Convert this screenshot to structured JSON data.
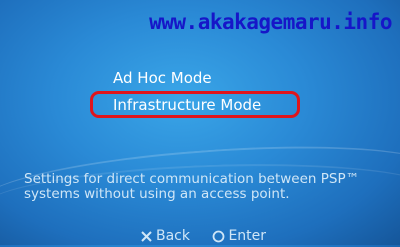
{
  "watermark": "www.akakagemaru.info",
  "menu": {
    "items": [
      {
        "label": "Ad Hoc Mode"
      },
      {
        "label": "Infrastructure Mode"
      }
    ]
  },
  "description": "Settings for direct communication between PSP™ systems without using an access point.",
  "footer": {
    "back_label": "Back",
    "enter_label": "Enter",
    "back_icon": "cross-icon",
    "enter_icon": "circle-icon"
  },
  "colors": {
    "highlight_border": "#e0151c",
    "watermark": "#1616c8"
  }
}
